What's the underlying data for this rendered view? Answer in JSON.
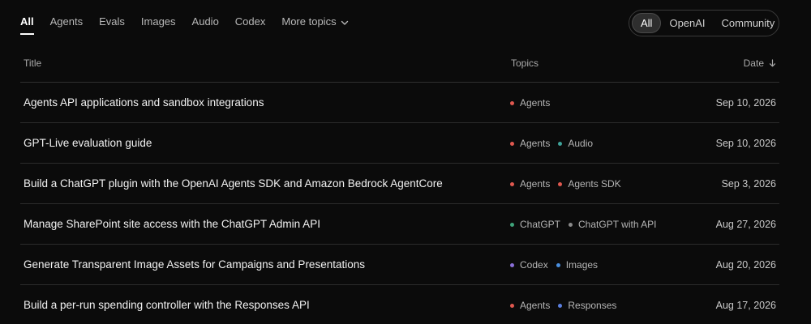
{
  "nav": {
    "tabs": [
      "All",
      "Agents",
      "Evals",
      "Images",
      "Audio",
      "Codex"
    ],
    "more_label": "More topics"
  },
  "source_filter": [
    "All",
    "OpenAI",
    "Community"
  ],
  "table": {
    "headers": {
      "title": "Title",
      "topics": "Topics",
      "date": "Date"
    },
    "rows": [
      {
        "title": "Agents API applications and sandbox integrations",
        "topics": [
          {
            "label": "Agents",
            "color": "#e0584f"
          }
        ],
        "date": "Sep 10, 2026"
      },
      {
        "title": "GPT-Live evaluation guide",
        "topics": [
          {
            "label": "Agents",
            "color": "#e0584f"
          },
          {
            "label": "Audio",
            "color": "#3fa39a"
          }
        ],
        "date": "Sep 10, 2026"
      },
      {
        "title": "Build a ChatGPT plugin with the OpenAI Agents SDK and Amazon Bedrock AgentCore",
        "topics": [
          {
            "label": "Agents",
            "color": "#e0584f"
          },
          {
            "label": "Agents SDK",
            "color": "#e0584f"
          }
        ],
        "date": "Sep 3, 2026"
      },
      {
        "title": "Manage SharePoint site access with the ChatGPT Admin API",
        "topics": [
          {
            "label": "ChatGPT",
            "color": "#3fa37a"
          },
          {
            "label": "ChatGPT with API",
            "color": "#8a8a8a"
          }
        ],
        "date": "Aug 27, 2026"
      },
      {
        "title": "Generate Transparent Image Assets for Campaigns and Presentations",
        "topics": [
          {
            "label": "Codex",
            "color": "#8a6fd8"
          },
          {
            "label": "Images",
            "color": "#4a8fe0"
          }
        ],
        "date": "Aug 20, 2026"
      },
      {
        "title": "Build a per-run spending controller with the Responses API",
        "topics": [
          {
            "label": "Agents",
            "color": "#e0584f"
          },
          {
            "label": "Responses",
            "color": "#5b7fe0"
          }
        ],
        "date": "Aug 17, 2026"
      }
    ]
  }
}
